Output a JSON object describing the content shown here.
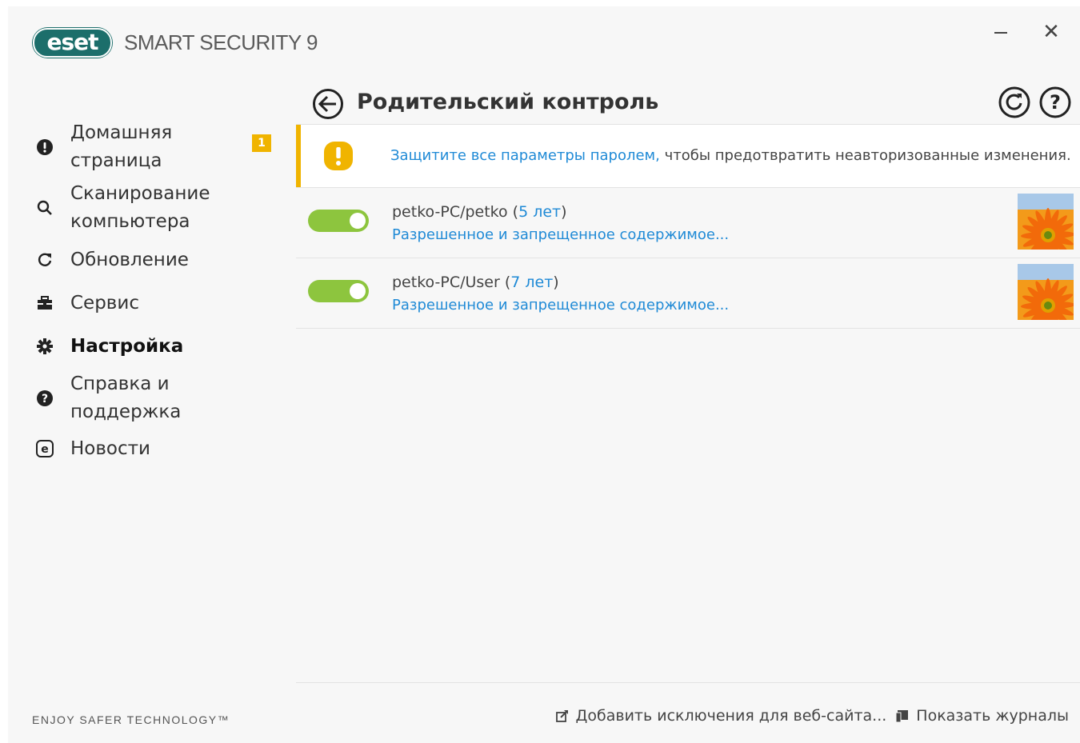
{
  "app": {
    "logo_text": "eset",
    "product_name": "SMART SECURITY 9",
    "tagline": "ENJOY SAFER TECHNOLOGY™"
  },
  "window_controls": {
    "minimize": "–",
    "close": "✕"
  },
  "sidebar": {
    "items": [
      {
        "label": "Домашняя страница",
        "icon": "alert-circle-icon",
        "badge": "1"
      },
      {
        "label": "Сканирование компьютера",
        "icon": "search-icon"
      },
      {
        "label": "Обновление",
        "icon": "refresh-icon"
      },
      {
        "label": "Сервис",
        "icon": "toolbox-icon"
      },
      {
        "label": "Настройка",
        "icon": "gear-icon",
        "active": true
      },
      {
        "label": "Справка и поддержка",
        "icon": "question-icon"
      },
      {
        "label": "Новости",
        "icon": "news-icon"
      }
    ]
  },
  "main": {
    "title": "Родительский контроль",
    "warning": {
      "link_text": "Защитите все параметры паролем,",
      "text": " чтобы предотвратить неавторизованные изменения."
    },
    "users": [
      {
        "name": "petko-PC/petko",
        "age_open": " (",
        "age": "5 лет",
        "age_close": ")",
        "link": "Разрешенное и запрещенное содержимое...",
        "enabled": true
      },
      {
        "name": "petko-PC/User",
        "age_open": " (",
        "age": "7 лет",
        "age_close": ")",
        "link": "Разрешенное и запрещенное содержимое...",
        "enabled": true
      }
    ]
  },
  "footer": {
    "add_exclusion": "Добавить исключения для веб-сайта...",
    "show_logs": "Показать журналы"
  },
  "colors": {
    "accent_link": "#1f8ad6",
    "toggle_on": "#8dc53e",
    "warning": "#f0b400",
    "brand": "#1c6e6b"
  }
}
